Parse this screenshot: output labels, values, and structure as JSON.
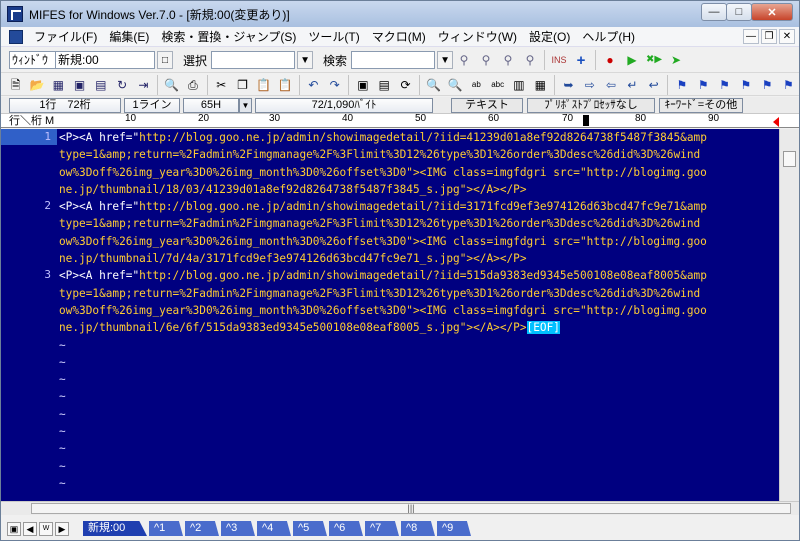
{
  "window": {
    "title": "MIFES for Windows Ver.7.0 - [新規:00(変更あり)]"
  },
  "menubar": {
    "items": [
      "ファイル(F)",
      "編集(E)",
      "検索・置換・ジャンプ(S)",
      "ツール(T)",
      "マクロ(M)",
      "ウィンドウ(W)",
      "設定(O)",
      "ヘルプ(H)"
    ]
  },
  "toolbar": {
    "window_label": "ｳｨﾝﾄﾞｳ",
    "window_value": "新規:00",
    "select_label": "選択",
    "search_label": "検索",
    "select_value": "",
    "search_value": ""
  },
  "status": {
    "position": "1行　72桁",
    "lines": "1ライン",
    "code": "65H",
    "size": "72/1,090ﾊﾞｲﾄ",
    "mode": "テキスト",
    "proportional": "ﾌﾟﾘﾎﾟｽﾄﾌﾟﾛｾｯｻなし",
    "keyword": "ｷｰﾜｰﾄﾞ=その他"
  },
  "ruler": {
    "label": "行＼桁 M",
    "ticks": [
      "10",
      "20",
      "30",
      "40",
      "50",
      "60",
      "70",
      "80",
      "90"
    ]
  },
  "editor": {
    "line_numbers": [
      "1",
      "2",
      "3"
    ],
    "lines": [
      [
        "<P><A href=\"",
        "http://blog.goo.ne.jp/admin/showimagedetail/?iid=41239d01a8ef92d8264738f5487f3845&amp"
      ],
      [
        "",
        "type=1&amp;return=%2Fadmin%2Fimgmanage%2F%3Flimit%3D12%26type%3D1%26order%3Ddesc%26did%3D%26wind"
      ],
      [
        "",
        "ow%3Doff%26img_year%3D0%26img_month%3D0%26offset%3D0\"><IMG class=imgfdgri src=\"http://blogimg.goo"
      ],
      [
        "",
        "ne.jp/thumbnail/18/03/41239d01a8ef92d8264738f5487f3845_s.jpg\"></A></P>"
      ],
      [
        "<P><A href=\"",
        "http://blog.goo.ne.jp/admin/showimagedetail/?iid=3171fcd9ef3e974126d63bcd47fc9e71&amp"
      ],
      [
        "",
        "type=1&amp;return=%2Fadmin%2Fimgmanage%2F%3Flimit%3D12%26type%3D1%26order%3Ddesc%26did%3D%26wind"
      ],
      [
        "",
        "ow%3Doff%26img_year%3D0%26img_month%3D0%26offset%3D0\"><IMG class=imgfdgri src=\"http://blogimg.goo"
      ],
      [
        "",
        "ne.jp/thumbnail/7d/4a/3171fcd9ef3e974126d63bcd47fc9e71_s.jpg\"></A></P>"
      ],
      [
        "<P><A href=\"",
        "http://blog.goo.ne.jp/admin/showimagedetail/?iid=515da9383ed9345e500108e08eaf8005&amp"
      ],
      [
        "",
        "type=1&amp;return=%2Fadmin%2Fimgmanage%2F%3Flimit%3D12%26type%3D1%26order%3Ddesc%26did%3D%26wind"
      ],
      [
        "",
        "ow%3Doff%26img_year%3D0%26img_month%3D0%26offset%3D0\"><IMG class=imgfdgri src=\"http://blogimg.goo"
      ],
      [
        "",
        "ne.jp/thumbnail/6e/6f/515da9383ed9345e500108e08eaf8005_s.jpg\"></A></P>"
      ]
    ],
    "eof": "[EOF]",
    "tilde": "~"
  },
  "tabs": [
    "新規:00",
    "^1",
    "^2",
    "^3",
    "^4",
    "^5",
    "^6",
    "^7",
    "^8",
    "^9"
  ],
  "colors": {
    "editor_bg": "#000080",
    "string": "#ffcc33",
    "eof": "#00c0ff"
  }
}
